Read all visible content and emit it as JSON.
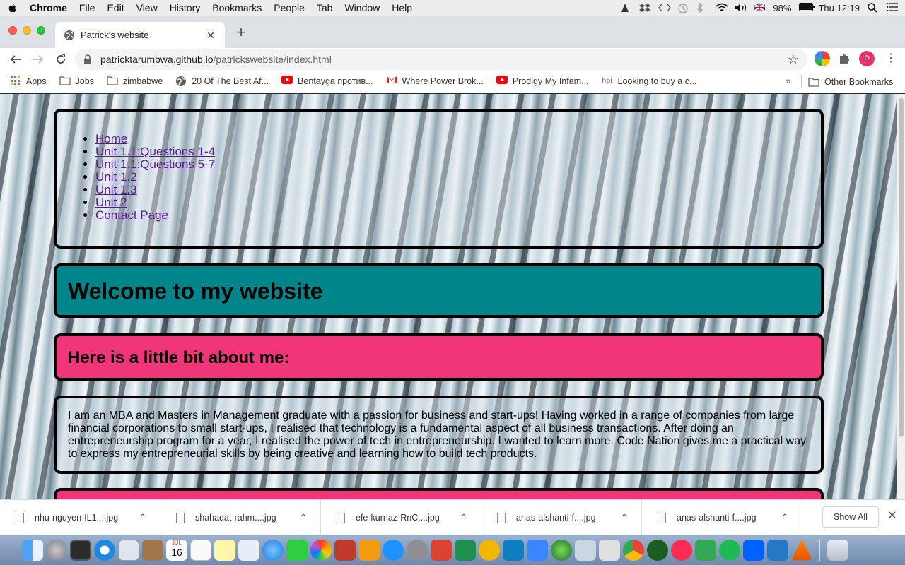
{
  "menubar": {
    "app_name": "Chrome",
    "items": [
      "File",
      "Edit",
      "View",
      "History",
      "Bookmarks",
      "People",
      "Tab",
      "Window",
      "Help"
    ],
    "battery": "98%",
    "clock": "Thu 12:19"
  },
  "tab": {
    "title": "Patrick's website"
  },
  "omnibox": {
    "host": "patricktarumbwa.github.io",
    "path": "/patrickswebsite/index.html"
  },
  "profile_initial": "P",
  "bookmarks": {
    "items": [
      {
        "label": "Apps",
        "icon": "apps-grid-icon"
      },
      {
        "label": "Jobs",
        "icon": "folder-icon"
      },
      {
        "label": "zimbabwe",
        "icon": "folder-icon"
      },
      {
        "label": "20 Of The Best Af...",
        "icon": "globe-icon"
      },
      {
        "label": "Bentayga против...",
        "icon": "youtube-icon"
      },
      {
        "label": "Where Power Brok...",
        "icon": "gmail-icon"
      },
      {
        "label": "Prodigy My Infam...",
        "icon": "youtube-icon"
      },
      {
        "label": "Looking to buy a c...",
        "icon": "hpi-icon"
      }
    ],
    "more": "»",
    "other": "Other Bookmarks"
  },
  "page": {
    "nav_links": [
      "Home",
      "Unit 1.1:Questions 1-4",
      "Unit 1.1:Questions 5-7",
      "Unit 1.2",
      "Unit 1.3",
      "Unit 2",
      "Contact Page"
    ],
    "welcome_heading": "Welcome to my website",
    "about_heading": "Here is a little bit about me:",
    "about_text": "I am an MBA and Masters in Management graduate with a passion for business and start-ups! Having worked in a range of companies from large financial corporations to small start-ups, I realised that technology is a fundamental aspect of all business transactions. After doing an entrepreneurship program for a year, I realised the power of tech in entrepreneurship. I wanted to learn more. Code Nation gives me a practical way to express my entrepreneurial skills by being creative and learning how to build tech products.",
    "colors": {
      "welcome_bg": "#00868a",
      "about_bg": "#f0357a"
    }
  },
  "downloads": {
    "files": [
      "nhu-nguyen-IL1....jpg",
      "shahadat-rahm....jpg",
      "efe-kurnaz-RnC....jpg",
      "anas-alshanti-f....jpg",
      "anas-alshanti-f....jpg"
    ],
    "show_all": "Show All"
  },
  "dock": {
    "calendar_month": "JUL",
    "calendar_day": "16"
  }
}
